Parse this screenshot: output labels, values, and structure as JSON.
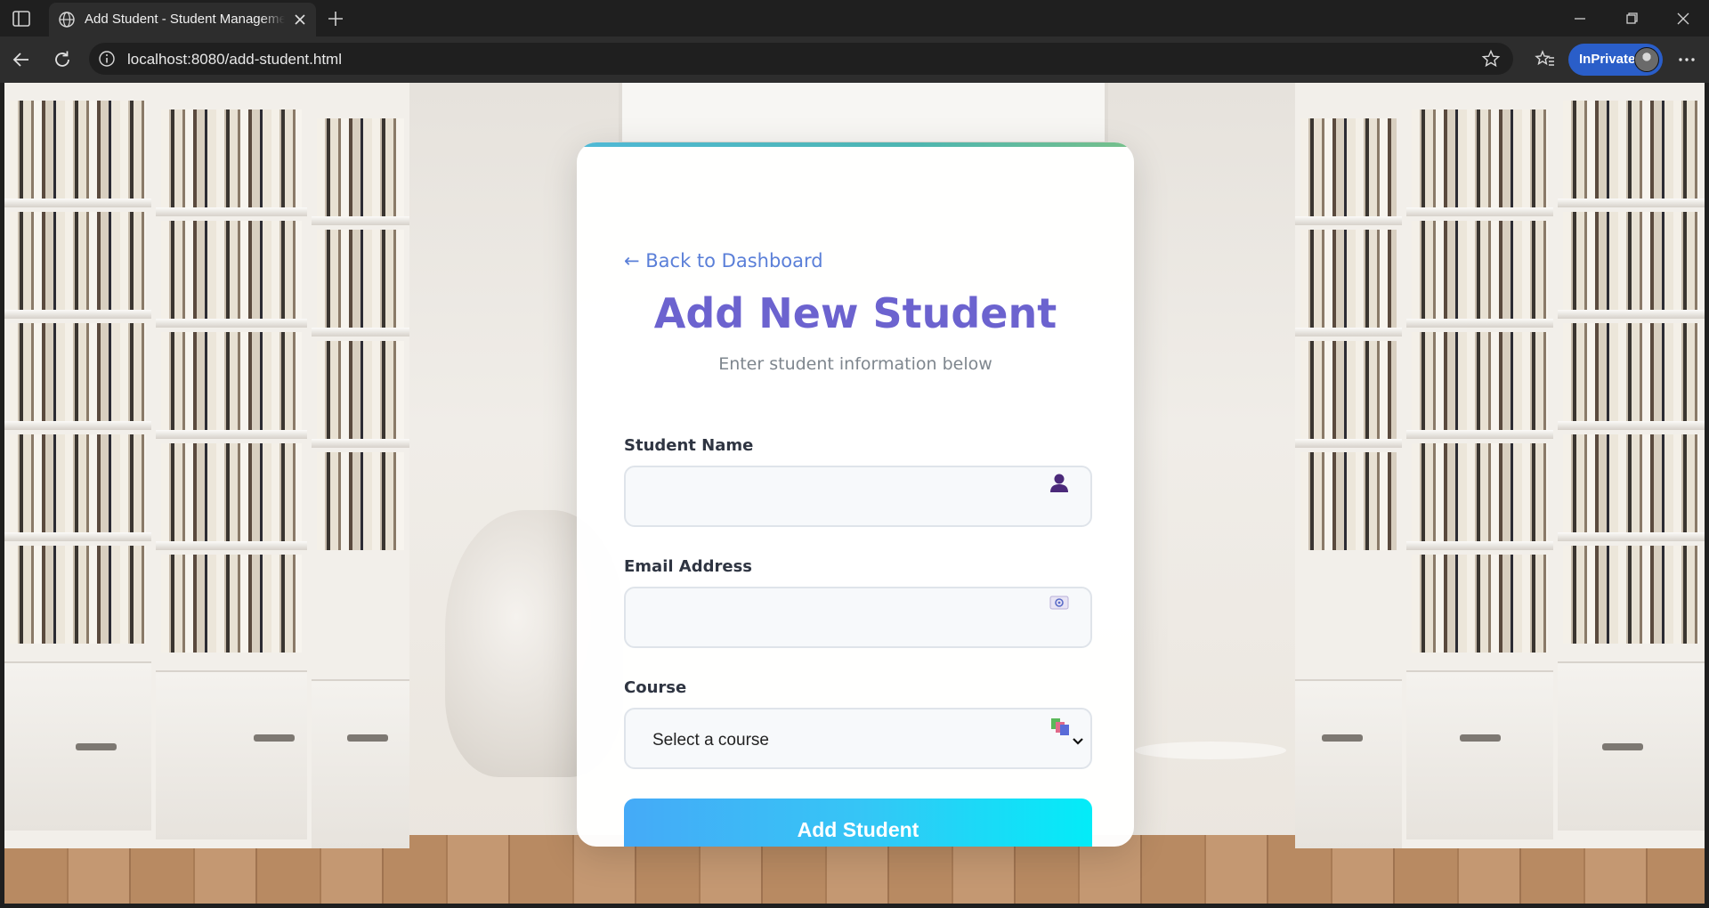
{
  "browser": {
    "tab_title": "Add Student - Student Management",
    "url": "localhost:8080/add-student.html",
    "profile_label": "InPrivate"
  },
  "page": {
    "back_link": "← Back to Dashboard",
    "title": "Add New Student",
    "subtitle": "Enter student information below",
    "fields": {
      "name": {
        "label": "Student Name",
        "value": "",
        "icon": "person-icon"
      },
      "email": {
        "label": "Email Address",
        "value": "",
        "icon": "email-icon"
      },
      "course": {
        "label": "Course",
        "selected": "Select a course",
        "icon": "books-icon"
      }
    },
    "submit_label": "Add Student"
  },
  "colors": {
    "title": "#6c63cf",
    "link": "#5a7fd8",
    "button_gradient_start": "#45aaf7",
    "button_gradient_end": "#03ecf8"
  }
}
